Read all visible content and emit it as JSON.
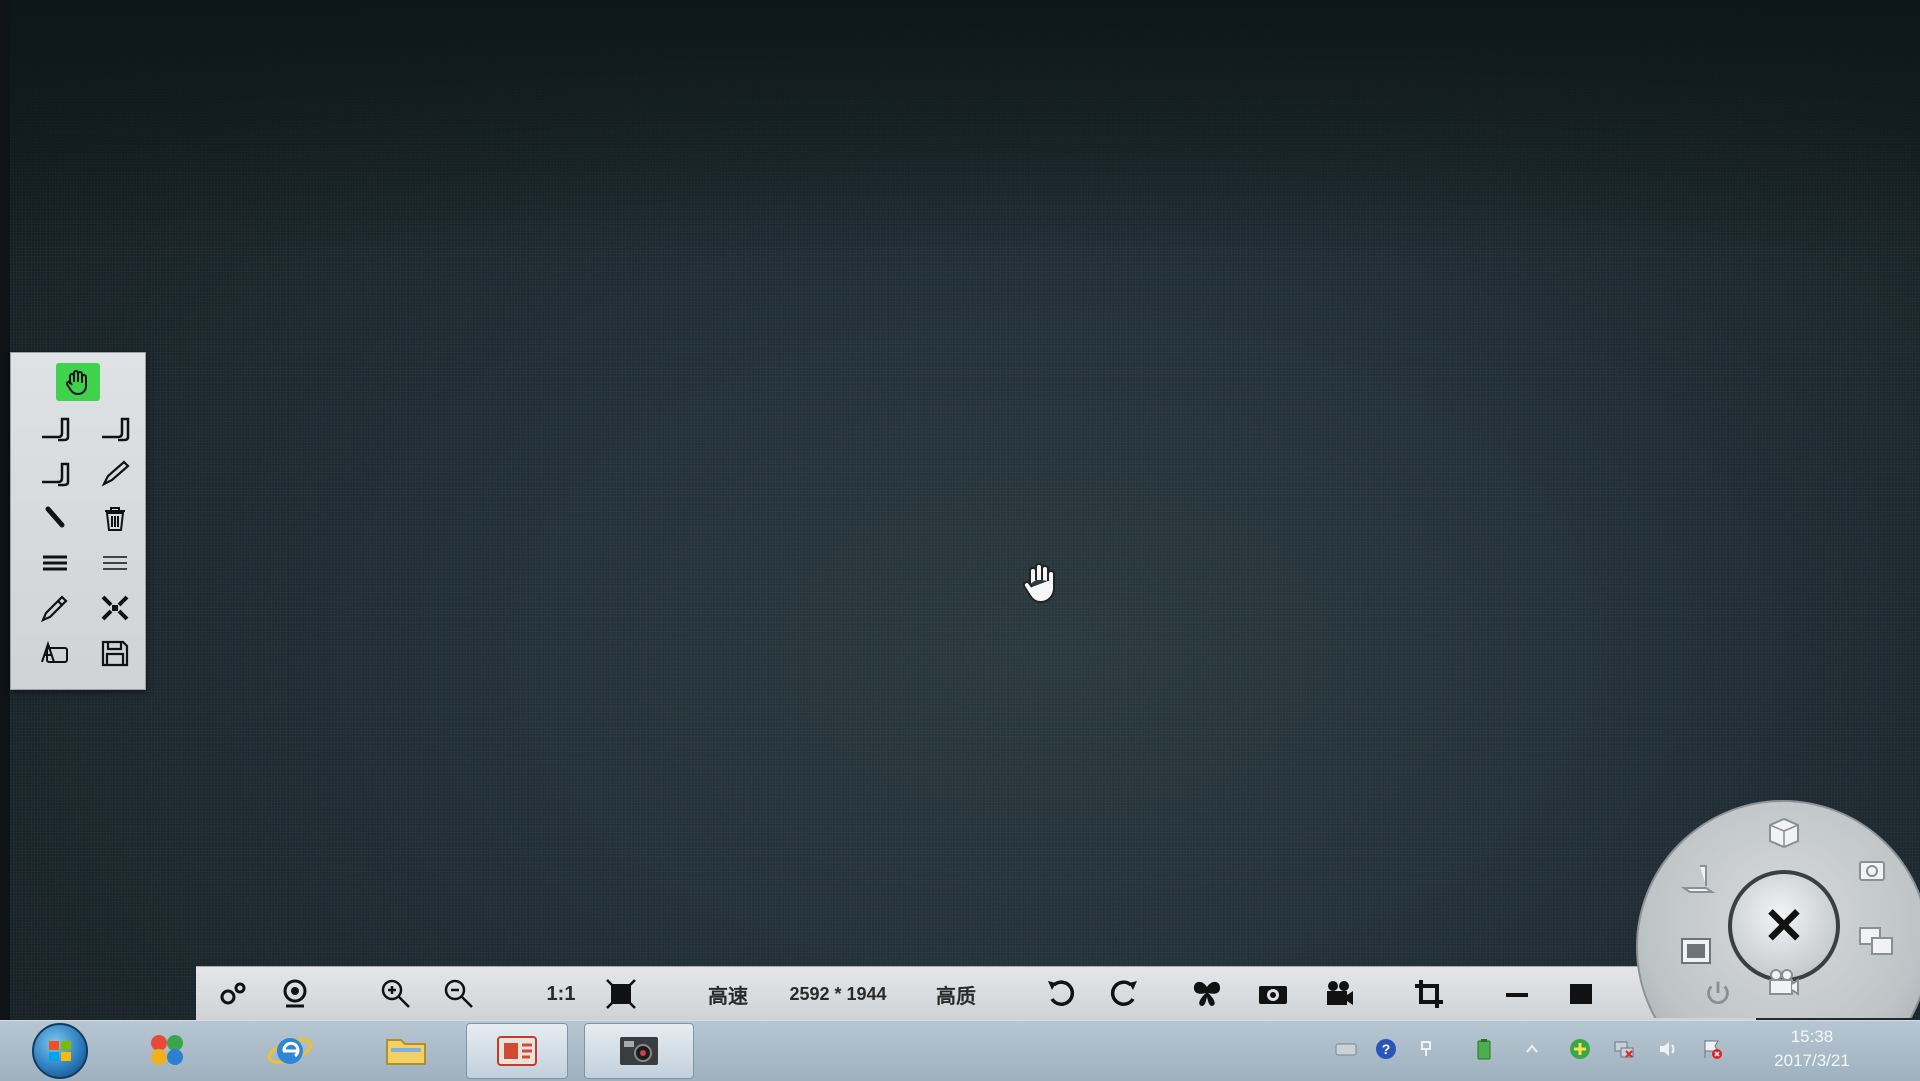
{
  "palette": {
    "tools": [
      {
        "name": "hand-tool",
        "active": true
      },
      {
        "name": "pen-tool-1"
      },
      {
        "name": "pen-tool-2"
      },
      {
        "name": "pen-tool-3"
      },
      {
        "name": "pencil-tool"
      },
      {
        "name": "eraser-tool"
      },
      {
        "name": "delete-tool"
      },
      {
        "name": "line-width-thick"
      },
      {
        "name": "line-width-thin"
      },
      {
        "name": "color-picker-tool"
      },
      {
        "name": "fullscreen-tool"
      },
      {
        "name": "text-tool"
      },
      {
        "name": "save-tool"
      }
    ],
    "active_color": "#3fd34d"
  },
  "toolbar": {
    "ratio_label": "1:1",
    "speed_label": "高速",
    "resolution_label": "2592 * 1944",
    "quality_label": "高质"
  },
  "taskbar": {
    "time": "15:38",
    "date": "2017/3/21"
  }
}
